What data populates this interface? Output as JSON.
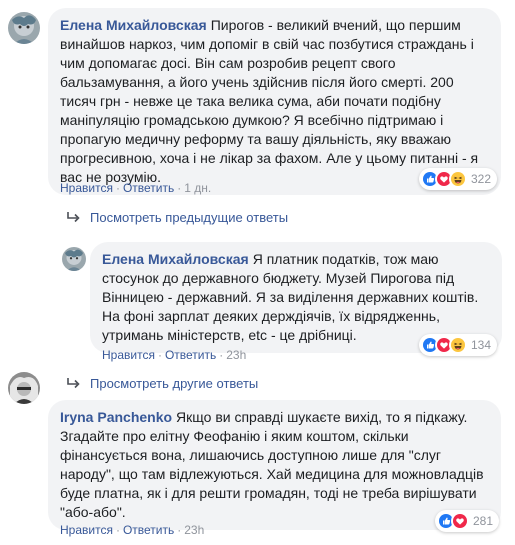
{
  "comments": [
    {
      "author": "Елена Михайловская",
      "text": "Пирогов - великий вчений, що першим винайшов наркоз, чим допоміг в свій час позбутися страждань і чим допомагає досі. Він сам розробив рецепт свого бальзамування, а його учень здійснив після його смерті. 200 тисяч грн - невже це така велика сума, аби почати подібну маніпуляцію громадською думкою? Я всебічно підтримаю і пропагую медичну реформу та вашу діяльність, яку вважаю прогресивною, хоча і не лікар за фахом. Але у цьому питанні - я вас не розумію.",
      "like": "Нравится",
      "reply": "Ответить",
      "time": "1 дн.",
      "reactions_count": "322"
    },
    {
      "author": "Елена Михайловская",
      "text": "Я платник податків, тож маю стосунок до державного бюджету. Музей Пирогова під Вінницею - державний. Я за виділення державних коштів. На фоні зарплат деяких держдіячів, їх відрядженнь, утримань міністерств, etc - це дрібниці.",
      "like": "Нравится",
      "reply": "Ответить",
      "time": "23h",
      "reactions_count": "134"
    },
    {
      "author": "Iryna Panchenko",
      "text": "Якщо ви справді шукаєте вихід, то я підкажу. Згадайте про елітну Феофанію і яким коштом, скільки фінансується вона, лишаючись доступною лише для \"слуг народу\", що там відлежуються. Хай медицина для можновладців буде платна, як і для решти громадян, тоді не треба вирішувати \"або-або\".",
      "like": "Нравится",
      "reply": "Ответить",
      "time": "23h",
      "reactions_count": "281"
    }
  ],
  "previous_replies": "Посмотреть предыдущие ответы",
  "other_replies": "Просмотреть другие ответы",
  "colors": {
    "link": "#385898",
    "meta": "#90949c",
    "bubble": "#f2f3f5",
    "like": "#2078f4",
    "love": "#f0284a",
    "haha": "#fcc63f"
  },
  "icons": [
    "like-reaction-icon",
    "love-reaction-icon",
    "haha-reaction-icon",
    "reply-arrow-icon"
  ]
}
